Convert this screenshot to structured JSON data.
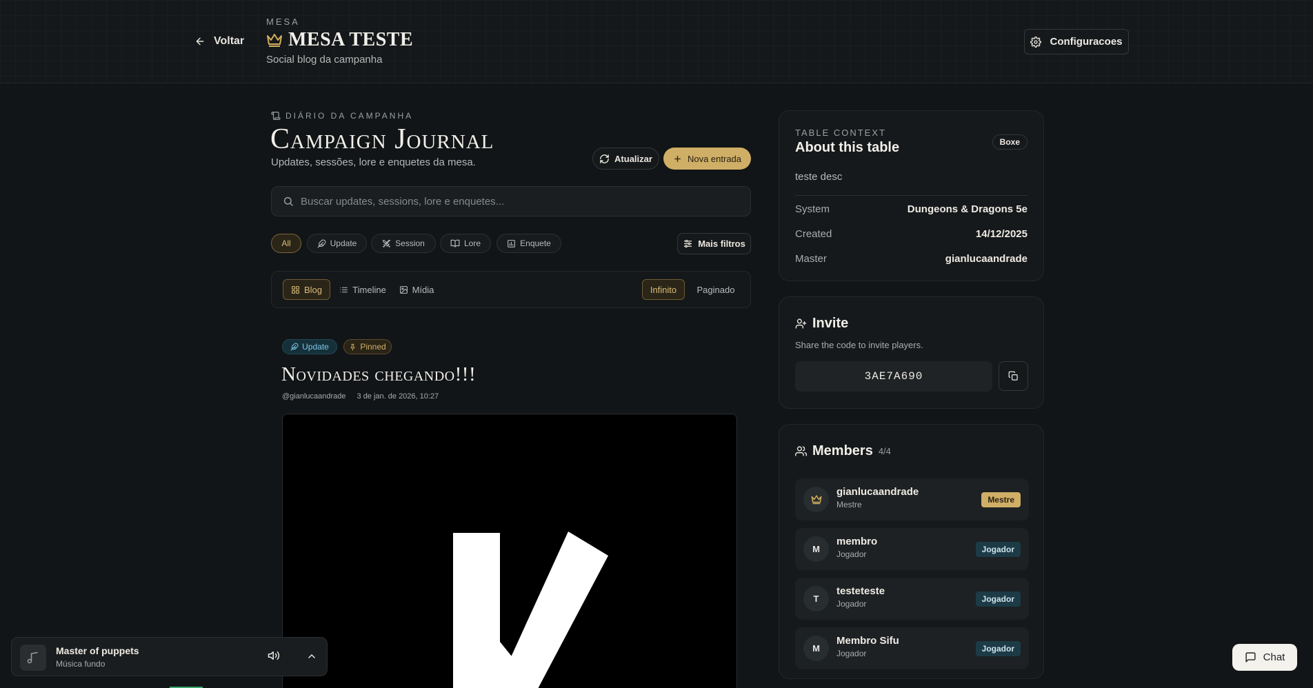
{
  "header": {
    "back_label": "Voltar",
    "kicker": "MESA",
    "title": "MESA TESTE",
    "subtitle": "Social blog da campanha",
    "config_label": "Configuracoes"
  },
  "journal": {
    "kicker": "DIÁRIO DA CAMPANHA",
    "title": "Campaign Journal",
    "subtitle": "Updates, sessões, lore e enquetes da mesa.",
    "refresh_label": "Atualizar",
    "new_entry_label": "Nova entrada",
    "search_placeholder": "Buscar updates, sessions, lore e enquetes...",
    "filters": [
      {
        "label": "All",
        "icon": "none",
        "active": true
      },
      {
        "label": "Update",
        "icon": "feather-icon"
      },
      {
        "label": "Session",
        "icon": "swords-icon"
      },
      {
        "label": "Lore",
        "icon": "book-icon"
      },
      {
        "label": "Enquete",
        "icon": "poll-icon"
      }
    ],
    "more_filters_label": "Mais filtros",
    "views": [
      {
        "label": "Blog",
        "icon": "grid-icon",
        "active": true
      },
      {
        "label": "Timeline",
        "icon": "list-icon"
      },
      {
        "label": "Mídia",
        "icon": "image-icon"
      }
    ],
    "pagination": [
      {
        "label": "Infinito",
        "active": true
      },
      {
        "label": "Paginado"
      }
    ]
  },
  "post": {
    "tag_update": "Update",
    "tag_pinned": "Pinned",
    "title": "Novidades chegando!!!",
    "author": "@gianlucaandrade",
    "date": "3 de jan. de 2026, 10:27"
  },
  "about": {
    "kicker": "TABLE CONTEXT",
    "title": "About this table",
    "badge": "Boxe",
    "description": "teste desc",
    "rows": [
      {
        "key": "System",
        "value": "Dungeons & Dragons 5e"
      },
      {
        "key": "Created",
        "value": "14/12/2025"
      },
      {
        "key": "Master",
        "value": "gianlucaandrade"
      }
    ]
  },
  "invite": {
    "title": "Invite",
    "subtitle": "Share the code to invite players.",
    "code": "3AE7A690"
  },
  "members": {
    "title": "Members",
    "count": "4/4",
    "list": [
      {
        "initial": "",
        "name": "gianlucaandrade",
        "role": "Mestre",
        "badge": "Mestre",
        "type": "mestre"
      },
      {
        "initial": "M",
        "name": "membro",
        "role": "Jogador",
        "badge": "Jogador",
        "type": "jogador"
      },
      {
        "initial": "T",
        "name": "testeteste",
        "role": "Jogador",
        "badge": "Jogador",
        "type": "jogador"
      },
      {
        "initial": "M",
        "name": "Membro Sifu",
        "role": "Jogador",
        "badge": "Jogador",
        "type": "jogador"
      }
    ]
  },
  "player": {
    "title": "Master of puppets",
    "subtitle": "Música fundo"
  },
  "chat": {
    "label": "Chat"
  },
  "colors": {
    "accent_gold": "#cfae66",
    "background": "#121517",
    "update_blue": "#7cc7e6"
  }
}
